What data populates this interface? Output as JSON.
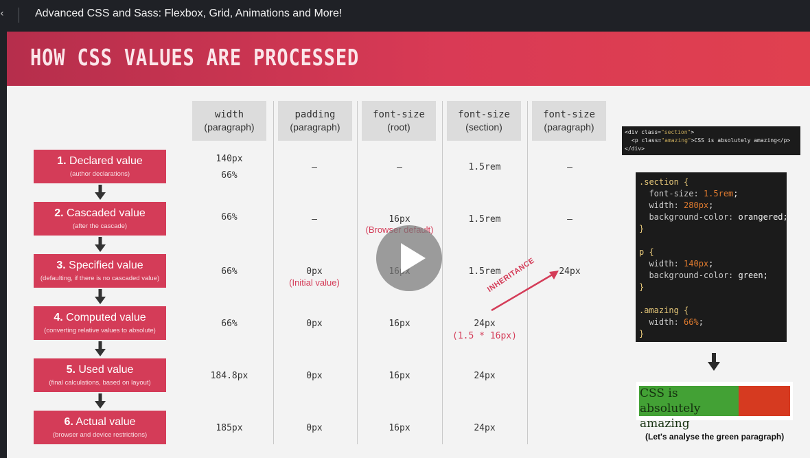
{
  "window": {
    "title": "Advanced CSS and Sass: Flexbox, Grid, Animations and More!"
  },
  "slide": {
    "title": "HOW CSS VALUES ARE PROCESSED",
    "columns": [
      {
        "prop": "width",
        "scope": "(paragraph)"
      },
      {
        "prop": "padding",
        "scope": "(paragraph)"
      },
      {
        "prop": "font-size",
        "scope": "(root)"
      },
      {
        "prop": "font-size",
        "scope": "(section)"
      },
      {
        "prop": "font-size",
        "scope": "(paragraph)"
      }
    ],
    "steps": [
      {
        "num": "1.",
        "name": "Declared value",
        "sub": "(author declarations)"
      },
      {
        "num": "2.",
        "name": "Cascaded value",
        "sub": "(after the cascade)"
      },
      {
        "num": "3.",
        "name": "Specified value",
        "sub": "(defaulting, if there is no cascaded value)"
      },
      {
        "num": "4.",
        "name": "Computed value",
        "sub": "(converting relative values to absolute)"
      },
      {
        "num": "5.",
        "name": "Used value",
        "sub": "(final calculations, based on layout)"
      },
      {
        "num": "6.",
        "name": "Actual value",
        "sub": "(browser and device restrictions)"
      }
    ],
    "cells": {
      "r1": {
        "c1a": "140px",
        "c1b": "66%",
        "c2": "–",
        "c3": "–",
        "c4": "1.5rem",
        "c5": "–"
      },
      "r2": {
        "c1": "66%",
        "c2": "–",
        "c3": "16px",
        "c3note": "(Browser default)",
        "c4": "1.5rem",
        "c5": "–"
      },
      "r3": {
        "c1": "66%",
        "c2": "0px",
        "c2note": "(Initial value)",
        "c3": "16px",
        "c4": "1.5rem",
        "c5": "24px"
      },
      "r4": {
        "c1": "66%",
        "c2": "0px",
        "c3": "16px",
        "c4": "24px",
        "c4note": "(1.5 * 16px)"
      },
      "r5": {
        "c1": "184.8px",
        "c2": "0px",
        "c3": "16px",
        "c4": "24px"
      },
      "r6": {
        "c1": "185px",
        "c2": "0px",
        "c3": "16px",
        "c4": "24px"
      }
    },
    "inheritance_label": "INHERITANCE",
    "html_snippet": {
      "line1_open": "<div class=",
      "line1_val": "\"section\"",
      "line1_close": ">",
      "line2_open": "<p class=",
      "line2_val": "\"amazing\"",
      "line2_text": ">CSS is absolutely amazing</p>",
      "line3": "</div>"
    },
    "css_code": {
      "l1": ".section {",
      "l2p": "font-size: ",
      "l2v": "1.5rem",
      "l2e": ";",
      "l3p": "width: ",
      "l3v": "280px",
      "l3e": ";",
      "l4p": "background-color: ",
      "l4v": "orangered;",
      "l5": "}",
      "l6": "p {",
      "l7p": "width: ",
      "l7v": "140px",
      "l7e": ";",
      "l8p": "background-color: ",
      "l8v": "green;",
      "l9": "}",
      "l10": ".amazing {",
      "l11p": "width: ",
      "l11v": "66%",
      "l11e": ";",
      "l12": "}"
    },
    "result_text": "CSS is absolutely amazing",
    "caption": "(Let's analyse the green paragraph)"
  },
  "colors": {
    "accent": "#d43c58",
    "banner": "#d93a55",
    "green": "#43a135",
    "orangered": "#d63a20"
  },
  "icons": {
    "play": "play-icon",
    "arrow": "down-arrow-icon"
  }
}
